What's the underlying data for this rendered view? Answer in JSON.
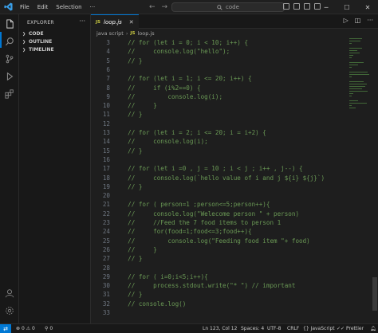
{
  "menu": [
    "File",
    "Edit",
    "Selection",
    "···"
  ],
  "search": {
    "placeholder": "code"
  },
  "sidebar": {
    "title": "EXPLORER",
    "sections": [
      "CODE",
      "OUTLINE",
      "TIMELINE"
    ]
  },
  "tab": {
    "badge": "JS",
    "label": "loop.js"
  },
  "breadcrumb": {
    "folder": "java script",
    "badge": "JS",
    "file": "loop.js"
  },
  "code_lines": [
    {
      "n": "3",
      "t": "  // for (let i = 0; i < 10; i++) {"
    },
    {
      "n": "4",
      "t": "  //     console.log(\"hello\");"
    },
    {
      "n": "5",
      "t": "  // }"
    },
    {
      "n": "6",
      "t": ""
    },
    {
      "n": "7",
      "t": "  // for (let i = 1; i <= 20; i++) {"
    },
    {
      "n": "8",
      "t": "  //     if (i%2==0) {"
    },
    {
      "n": "9",
      "t": "  //         console.log(i);"
    },
    {
      "n": "10",
      "t": "  //     }"
    },
    {
      "n": "11",
      "t": "  // }"
    },
    {
      "n": "12",
      "t": ""
    },
    {
      "n": "13",
      "t": "  // for (let i = 2; i <= 20; i = i+2) {"
    },
    {
      "n": "14",
      "t": "  //     console.log(i);"
    },
    {
      "n": "15",
      "t": "  // }"
    },
    {
      "n": "16",
      "t": ""
    },
    {
      "n": "17",
      "t": "  // for (let i =0 , j = 10 ; i < j ; i++ , j--) {"
    },
    {
      "n": "18",
      "t": "  //     console.log(`hello value of i and j ${i} ${j}`)"
    },
    {
      "n": "19",
      "t": "  // }"
    },
    {
      "n": "20",
      "t": ""
    },
    {
      "n": "21",
      "t": "  // for ( person=1 ;person<=5;person++){"
    },
    {
      "n": "22",
      "t": "  //     console.log(\"Welecome person \" + person)"
    },
    {
      "n": "23",
      "t": "  //     //Feed the 7 food items to person 1"
    },
    {
      "n": "24",
      "t": "  //     for(food=1;food<=3;food++){"
    },
    {
      "n": "25",
      "t": "  //         console.log(\"Feeding food item \"+ food)"
    },
    {
      "n": "26",
      "t": "  //     }"
    },
    {
      "n": "27",
      "t": "  // }"
    },
    {
      "n": "28",
      "t": ""
    },
    {
      "n": "29",
      "t": "  // for ( i=0;i<5;i++){"
    },
    {
      "n": "30",
      "t": "  //     process.stdout.write(\"* \") // important"
    },
    {
      "n": "31",
      "t": "  // }"
    },
    {
      "n": "32",
      "t": "  // console.log()"
    },
    {
      "n": "33",
      "t": ""
    }
  ],
  "status": {
    "errors": "0",
    "warnings": "0",
    "ports": "0",
    "position": "Ln 123, Col 12",
    "spaces": "Spaces: 4",
    "encoding": "UTF-8",
    "eol": "CRLF",
    "language": "JavaScript",
    "prettier": "Prettier"
  },
  "colors": {
    "accent": "#0078d4",
    "comment": "#6a9955",
    "js_badge": "#cbcb41"
  }
}
